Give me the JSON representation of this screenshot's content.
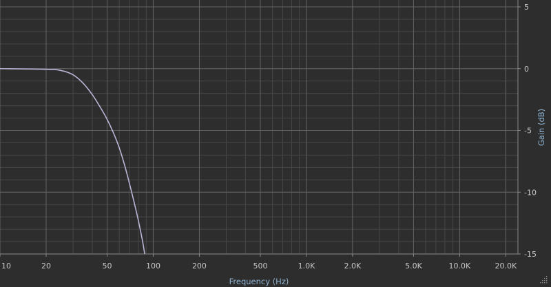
{
  "chart_data": {
    "type": "line",
    "title": "",
    "xlabel": "Frequency (Hz)",
    "ylabel": "Gain (dB)",
    "x_scale": "log",
    "xlim": [
      10,
      24000
    ],
    "ylim": [
      -15,
      5
    ],
    "grid": true,
    "x_ticks": [
      {
        "value": 10,
        "label": "10"
      },
      {
        "value": 20,
        "label": "20"
      },
      {
        "value": 50,
        "label": "50"
      },
      {
        "value": 100,
        "label": "100"
      },
      {
        "value": 200,
        "label": "200"
      },
      {
        "value": 500,
        "label": "500"
      },
      {
        "value": 1000,
        "label": "1.0K"
      },
      {
        "value": 2000,
        "label": "2.0K"
      },
      {
        "value": 5000,
        "label": "5.0K"
      },
      {
        "value": 10000,
        "label": "10.0K"
      },
      {
        "value": 20000,
        "label": "20.0K"
      }
    ],
    "y_ticks": [
      {
        "value": 5,
        "label": "5"
      },
      {
        "value": 0,
        "label": "0"
      },
      {
        "value": -5,
        "label": "-5"
      },
      {
        "value": -10,
        "label": "-10"
      },
      {
        "value": -15,
        "label": "-15"
      }
    ],
    "series": [
      {
        "color": "#b9b6d6",
        "x": [
          10,
          20,
          25,
          30,
          35,
          40,
          45,
          50,
          55,
          60,
          65,
          70,
          75,
          80,
          85,
          88
        ],
        "y": [
          0,
          -0.05,
          -0.15,
          -0.5,
          -1.2,
          -2.1,
          -3.1,
          -4.1,
          -5.2,
          -6.4,
          -7.8,
          -9.3,
          -10.8,
          -12.3,
          -13.9,
          -15
        ]
      }
    ]
  },
  "colors": {
    "background": "#2d2d2d",
    "grid_major": "#626262",
    "grid_minor": "#474747",
    "axis_line": "#8a8a8a",
    "tick_text": "#c8c8c8",
    "axis_title": "#8fb3d1"
  },
  "icons": {
    "resize_grip": "resize-grip-icon"
  }
}
